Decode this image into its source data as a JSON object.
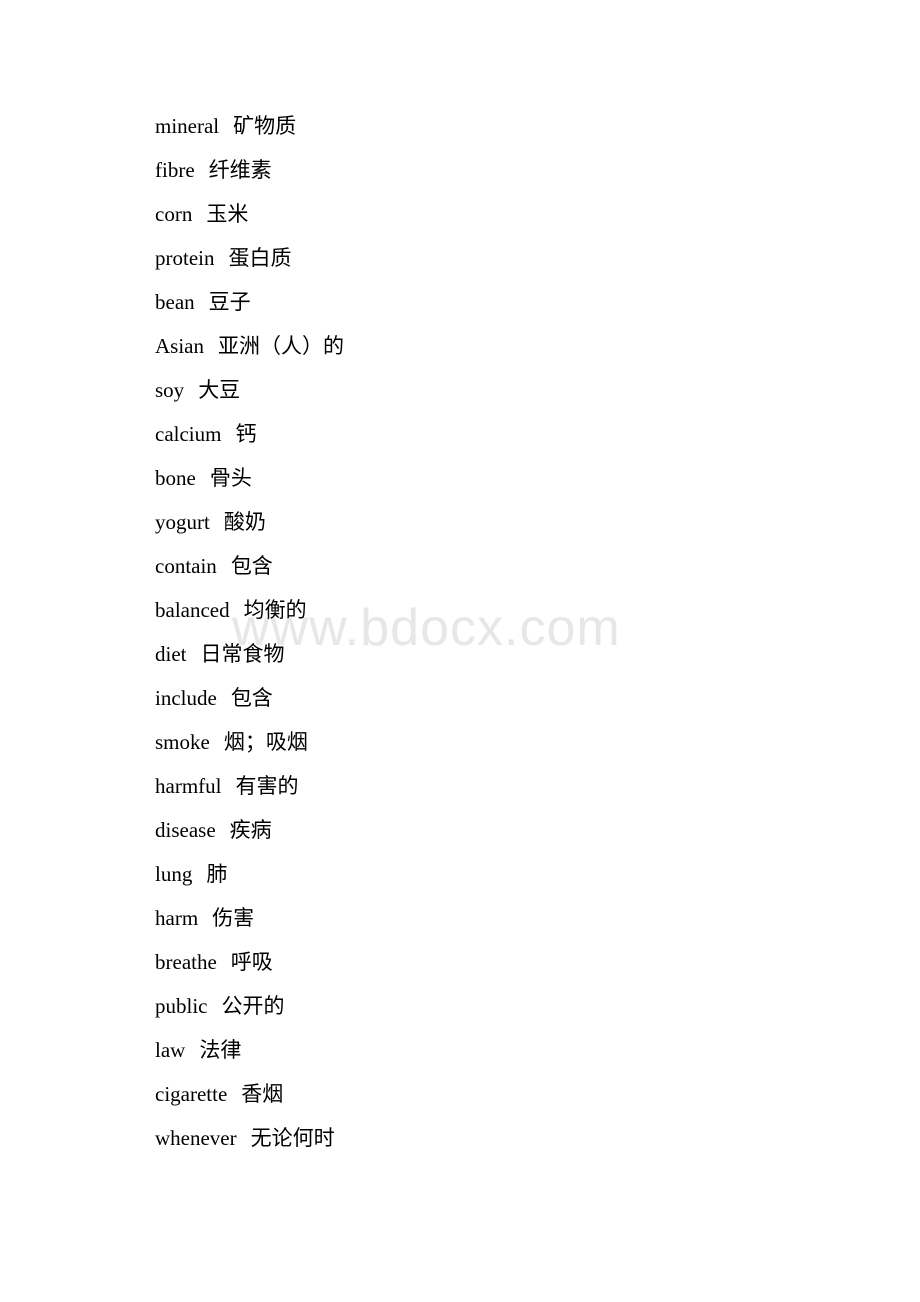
{
  "document": {
    "watermark": "www.bdocx.com",
    "background_color": "#ffffff",
    "text_color": "#000000",
    "watermark_color": "#e7e7e7",
    "entries": [
      {
        "term": "mineral",
        "gloss": "矿物质"
      },
      {
        "term": "fibre",
        "gloss": "纤维素"
      },
      {
        "term": "corn",
        "gloss": "玉米"
      },
      {
        "term": "protein",
        "gloss": "蛋白质"
      },
      {
        "term": "bean",
        "gloss": "豆子"
      },
      {
        "term": "Asian",
        "gloss": "亚洲（人）的"
      },
      {
        "term": "soy",
        "gloss": "大豆"
      },
      {
        "term": "calcium",
        "gloss": "钙"
      },
      {
        "term": "bone",
        "gloss": "骨头"
      },
      {
        "term": "yogurt",
        "gloss": "酸奶"
      },
      {
        "term": "contain",
        "gloss": "包含"
      },
      {
        "term": "balanced",
        "gloss": "均衡的"
      },
      {
        "term": "diet",
        "gloss": "日常食物"
      },
      {
        "term": "include",
        "gloss": "包含"
      },
      {
        "term": "smoke",
        "gloss": "烟；吸烟"
      },
      {
        "term": "harmful",
        "gloss": "有害的"
      },
      {
        "term": "disease",
        "gloss": "疾病"
      },
      {
        "term": "lung",
        "gloss": "肺"
      },
      {
        "term": "harm",
        "gloss": "伤害"
      },
      {
        "term": "breathe",
        "gloss": "呼吸"
      },
      {
        "term": "public",
        "gloss": "公开的"
      },
      {
        "term": "law",
        "gloss": "法律"
      },
      {
        "term": "cigarette",
        "gloss": "香烟"
      },
      {
        "term": "whenever",
        "gloss": "无论何时"
      }
    ]
  }
}
